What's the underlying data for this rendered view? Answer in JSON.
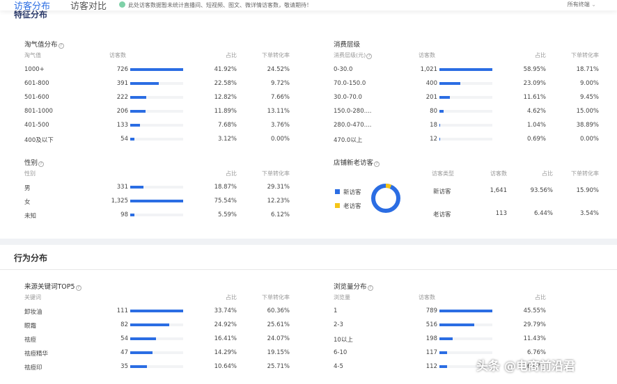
{
  "tabs": [
    {
      "label": "访客分布",
      "active": true
    },
    {
      "label": "访客对比",
      "active": false
    }
  ],
  "notice": "此处访客数据暂未统计直播间、短视频、图文、微详情访客数，敬请期待！",
  "terminal_select": "所有终端",
  "sections": {
    "feature": "特征分布",
    "behavior": "行为分布"
  },
  "colors": {
    "accent": "#2b6de3",
    "new_visitor": "#2b6de3",
    "old_visitor": "#f5c518"
  },
  "tables": {
    "taoqi": {
      "title": "淘气值分布",
      "headers": [
        "淘气值",
        "访客数",
        "占比",
        "下单转化率"
      ],
      "rows": [
        [
          "1000+",
          726,
          "41.92%",
          "24.52%"
        ],
        [
          "601-800",
          391,
          "22.58%",
          "9.72%"
        ],
        [
          "501-600",
          222,
          "12.82%",
          "7.66%"
        ],
        [
          "801-1000",
          206,
          "11.89%",
          "13.11%"
        ],
        [
          "401-500",
          133,
          "7.68%",
          "3.76%"
        ],
        [
          "400及以下",
          54,
          "3.12%",
          "0.00%"
        ]
      ]
    },
    "spend": {
      "title": "消费层级",
      "headers": [
        "消费层级(元)",
        "访客数",
        "占比",
        "下单转化率"
      ],
      "rows": [
        [
          "0-30.0",
          1021,
          "58.95%",
          "18.71%"
        ],
        [
          "70.0-150.0",
          400,
          "23.09%",
          "9.00%"
        ],
        [
          "30.0-70.0",
          201,
          "11.61%",
          "9.45%"
        ],
        [
          "150.0-280....",
          80,
          "4.62%",
          "15.00%"
        ],
        [
          "280.0-470....",
          18,
          "1.04%",
          "38.89%"
        ],
        [
          "470.0以上",
          12,
          "0.69%",
          "0.00%"
        ]
      ]
    },
    "gender": {
      "title": "性别",
      "headers": [
        "性别",
        "",
        "占比",
        "下单转化率"
      ],
      "rows": [
        [
          "男",
          331,
          "18.87%",
          "29.31%"
        ],
        [
          "女",
          1325,
          "75.54%",
          "12.23%"
        ],
        [
          "未知",
          98,
          "5.59%",
          "6.12%"
        ]
      ]
    },
    "keywords": {
      "title": "来源关键词TOP5",
      "headers": [
        "关键词",
        "",
        "占比",
        "下单转化率"
      ],
      "rows": [
        [
          "卸妆油",
          111,
          "33.74%",
          "60.36%"
        ],
        [
          "眼霜",
          82,
          "24.92%",
          "25.61%"
        ],
        [
          "祛痘",
          54,
          "16.41%",
          "24.07%"
        ],
        [
          "祛痘精华",
          47,
          "14.29%",
          "19.15%"
        ],
        [
          "祛痘印",
          35,
          "10.64%",
          "25.71%"
        ]
      ]
    },
    "views": {
      "title": "浏览量分布",
      "headers": [
        "浏览量",
        "访客数",
        "占比",
        ""
      ],
      "rows": [
        [
          "1",
          789,
          "45.55%",
          ""
        ],
        [
          "2-3",
          516,
          "29.79%",
          ""
        ],
        [
          "10以上",
          198,
          "11.43%",
          ""
        ],
        [
          "6-10",
          117,
          "6.76%",
          ""
        ],
        [
          "4-5",
          112,
          "6.47%",
          ""
        ]
      ]
    }
  },
  "newold": {
    "title": "店铺新老访客",
    "legend": [
      "新访客",
      "老访客"
    ],
    "headers": [
      "访客类型",
      "访客数",
      "占比",
      "下单转化率"
    ],
    "rows": [
      [
        "新访客",
        "1,641",
        "93.56%",
        "15.90%"
      ],
      [
        "老访客",
        "113",
        "6.44%",
        "3.54%"
      ]
    ],
    "new_fraction": 0.9356
  },
  "watermark": "头条 @电商前沿君"
}
